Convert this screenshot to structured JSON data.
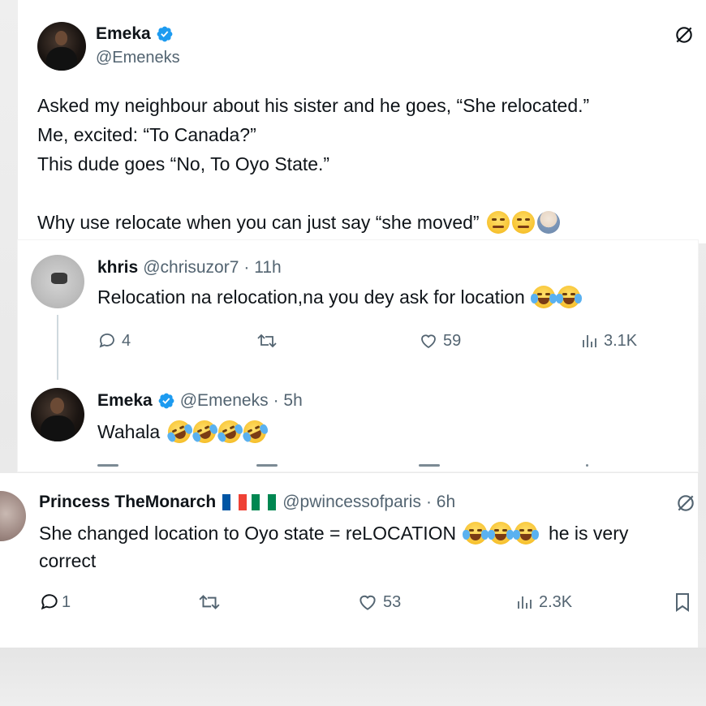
{
  "main_tweet": {
    "name": "Emeka",
    "handle": "@Emeneks",
    "lines": [
      "Asked my neighbour about his sister and he goes, “She relocated.”",
      "Me, excited: “To Canada?”",
      "This dude goes “No, To Oyo State.”",
      "",
      "Why use relocate when you can just say “she moved”"
    ],
    "trailing_emojis": [
      "unamused-face",
      "unamused-face",
      "man-facepalming"
    ]
  },
  "reply1": {
    "name": "khris",
    "handle": "@chrisuzor7",
    "time": "· 11h",
    "text": "Relocation na relocation,na you dey ask for location",
    "emojis": [
      "tears-of-joy",
      "tears-of-joy"
    ],
    "replies": "4",
    "likes": "59",
    "views": "3.1K"
  },
  "reply2": {
    "name": "Emeka",
    "handle": "@Emeneks",
    "time": "· 5h",
    "text": "Wahala",
    "emojis": [
      "rolling-on-floor-laughing",
      "rolling-on-floor-laughing",
      "rolling-on-floor-laughing",
      "rolling-on-floor-laughing"
    ]
  },
  "reply3": {
    "name": "Princess TheMonarch",
    "flags": [
      "france-flag",
      "nigeria-flag"
    ],
    "handle": "@pwincessofparis",
    "time": "· 6h",
    "text_part1": "She changed location to Oyo state = reLOCATION",
    "emojis": [
      "tears-of-joy",
      "tears-of-joy",
      "tears-of-joy"
    ],
    "text_part2": "he is very",
    "text_line2": "correct",
    "replies": "1",
    "likes": "53",
    "views": "2.3K"
  },
  "colors": {
    "verified": "#1d9bf0",
    "text": "#0f1419",
    "muted": "#536471",
    "thread_line": "#cfd9de"
  }
}
